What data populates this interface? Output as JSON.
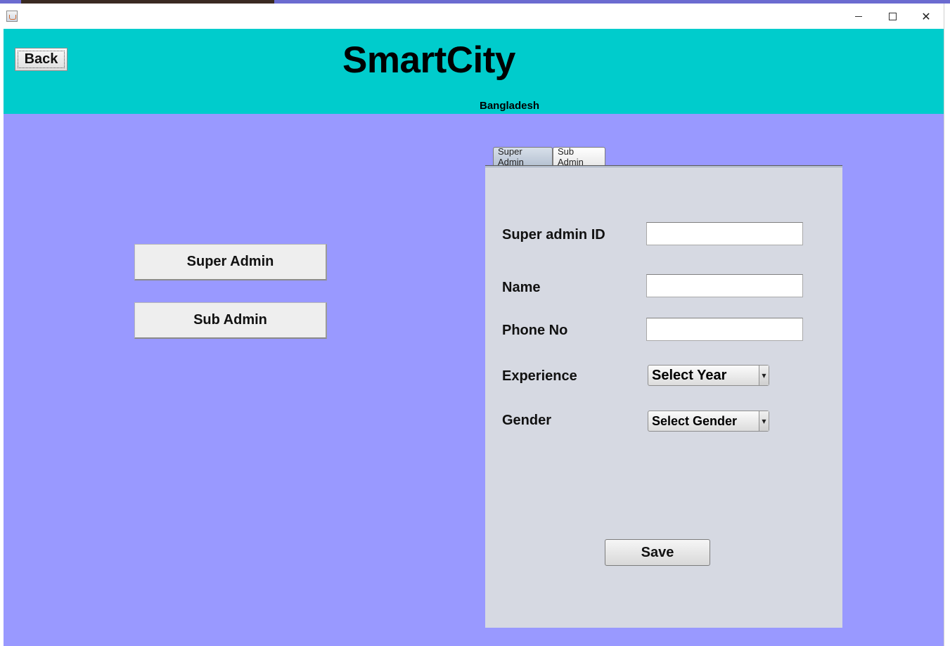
{
  "window": {
    "minimize_glyph": "–",
    "maximize_glyph": "□",
    "close_glyph": "✕"
  },
  "header": {
    "back_label": "Back",
    "title": "SmartCity",
    "subtitle": "Bangladesh",
    "background": "#00cccc"
  },
  "sidebar": {
    "super_admin_label": "Super Admin",
    "sub_admin_label": "Sub Admin"
  },
  "tabs": [
    {
      "label": "Super Admin",
      "selected": true
    },
    {
      "label": "Sub Admin",
      "selected": false
    }
  ],
  "form": {
    "super_admin_id": {
      "label": "Super admin ID",
      "value": ""
    },
    "name": {
      "label": "Name",
      "value": ""
    },
    "phone": {
      "label": "Phone No",
      "value": ""
    },
    "experience": {
      "label": "Experience",
      "selected": "Select Year"
    },
    "gender": {
      "label": "Gender",
      "selected": "Select Gender"
    },
    "save_label": "Save"
  },
  "colors": {
    "main_background": "#9999ff",
    "panel_background": "#d6d9e2"
  }
}
